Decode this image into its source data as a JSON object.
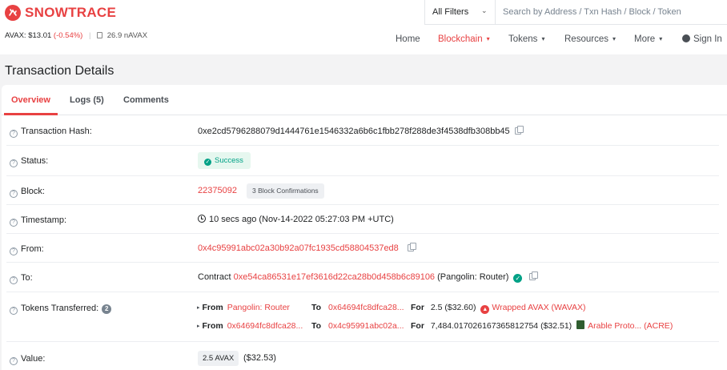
{
  "brand": {
    "name": "SNOWTRACE",
    "color": "#e84142"
  },
  "ticker": {
    "price": "AVAX: $13.01",
    "change": "(-0.54%)",
    "separator": "|",
    "gas": "26.9 nAVAX"
  },
  "search": {
    "filter": "All Filters",
    "placeholder": "Search by Address / Txn Hash / Block / Token"
  },
  "nav": [
    {
      "label": "Home",
      "icon": ""
    },
    {
      "label": "Blockchain",
      "icon": "chevron-down"
    },
    {
      "label": "Tokens",
      "icon": "chevron-down"
    },
    {
      "label": "Resources",
      "icon": "chevron-down"
    },
    {
      "label": "More",
      "icon": "chevron-down"
    },
    {
      "label": "Sign In",
      "icon": "user-circle"
    }
  ],
  "page_title": "Transaction Details",
  "tabs": [
    "Overview",
    "Logs (5)",
    "Comments"
  ],
  "details": {
    "hash": {
      "label": "Transaction Hash:",
      "value": "0xe2cd5796288079d1444761e1546332a6b6c1fbb278f288de3f4538dfb308bb45"
    },
    "status": {
      "label": "Status:",
      "value": "Success"
    },
    "block": {
      "label": "Block:",
      "value": "22375092",
      "confirmations": "3 Block Confirmations"
    },
    "timestamp": {
      "label": "Timestamp:",
      "value": "10 secs ago (Nov-14-2022 05:27:03 PM +UTC)"
    },
    "from": {
      "label": "From:",
      "value": "0x4c95991abc02a30b92a07fc1935cd58804537ed8"
    },
    "to": {
      "label": "To:",
      "prefix": "Contract",
      "address": "0xe54ca86531e17ef3616d22ca28b0d458b6c89106",
      "name": "(Pangolin: Router)"
    },
    "tokens": {
      "label": "Tokens Transferred:",
      "count": "2",
      "transfers": [
        {
          "from_word": "From",
          "from": "Pangolin: Router",
          "to_word": "To",
          "to": "0x64694fc8dfca28...",
          "for_word": "For",
          "amount": "2.5 ($32.60)",
          "token": "Wrapped AVAX (WAVAX)"
        },
        {
          "from_word": "From",
          "from": "0x64694fc8dfca28...",
          "to_word": "To",
          "to": "0x4c95991abc02a...",
          "for_word": "For",
          "amount": "7,484.017026167365812754 ($32.51)",
          "token": "Arable Proto... (ACRE)"
        }
      ]
    },
    "value": {
      "label": "Value:",
      "amount": "2.5 AVAX",
      "usd": "($32.53)"
    }
  }
}
